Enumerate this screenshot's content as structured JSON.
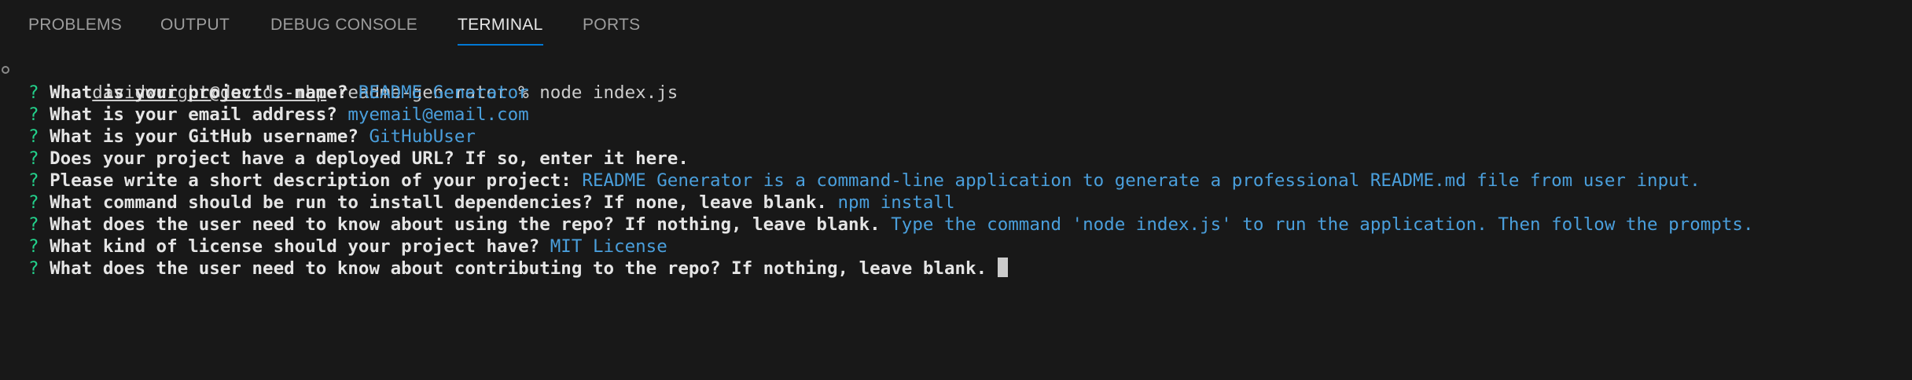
{
  "tabs": [
    {
      "label": "PROBLEMS",
      "active": false
    },
    {
      "label": "OUTPUT",
      "active": false
    },
    {
      "label": "DEBUG CONSOLE",
      "active": false
    },
    {
      "label": "TERMINAL",
      "active": true
    },
    {
      "label": "PORTS",
      "active": false
    }
  ],
  "colors": {
    "background": "#181818",
    "active_tab_underline": "#0078d4",
    "question_mark": "#23d18b",
    "answer": "#4a9fdc"
  },
  "terminal": {
    "command_line": {
      "user_host": "davidwright@davids-mbp",
      "directory": "readme-generator",
      "prompt_symbol": "%",
      "command": "node index.js"
    },
    "qa": [
      {
        "mark": "?",
        "question": "What is your project's name?",
        "answer": "README Generator"
      },
      {
        "mark": "?",
        "question": "What is your email address?",
        "answer": "myemail@email.com"
      },
      {
        "mark": "?",
        "question": "What is your GitHub username?",
        "answer": "GitHubUser"
      },
      {
        "mark": "?",
        "question": "Does your project have a deployed URL? If so, enter it here.",
        "answer": ""
      },
      {
        "mark": "?",
        "question": "Please write a short description of your project:",
        "answer": "README Generator is a command-line application to generate a professional README.md file from user input."
      },
      {
        "mark": "?",
        "question": "What command should be run to install dependencies? If none, leave blank.",
        "answer": "npm install"
      },
      {
        "mark": "?",
        "question": "What does the user need to know about using the repo? If nothing, leave blank.",
        "answer": "Type the command 'node index.js' to run the application. Then follow the prompts."
      },
      {
        "mark": "?",
        "question": "What kind of license should your project have?",
        "answer": "MIT License"
      },
      {
        "mark": "?",
        "question": "What does the user need to know about contributing to the repo? If nothing, leave blank.",
        "answer": ""
      }
    ]
  }
}
